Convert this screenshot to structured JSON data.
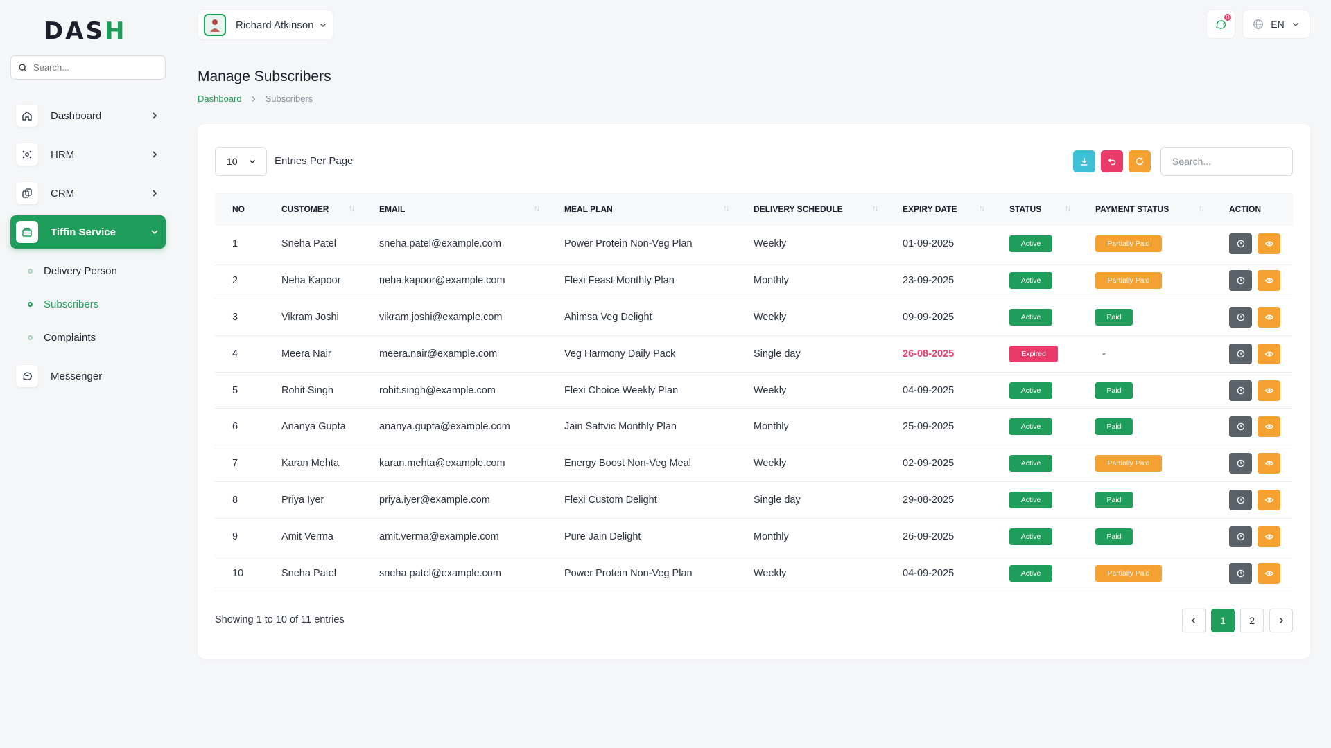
{
  "brand": {
    "logo_main": "DAS",
    "logo_accent": "H"
  },
  "sidebar": {
    "search_placeholder": "Search...",
    "items": [
      {
        "label": "Dashboard",
        "icon": "home-icon"
      },
      {
        "label": "HRM",
        "icon": "hrm-icon"
      },
      {
        "label": "CRM",
        "icon": "crm-icon"
      },
      {
        "label": "Tiffin Service",
        "icon": "tiffin-icon",
        "active": true
      },
      {
        "label": "Messenger",
        "icon": "chat-icon"
      }
    ],
    "sub_items": [
      {
        "label": "Delivery Person"
      },
      {
        "label": "Subscribers",
        "current": true
      },
      {
        "label": "Complaints"
      }
    ]
  },
  "header": {
    "user_name": "Richard Atkinson",
    "notification_count": "0",
    "language": "EN"
  },
  "page": {
    "title": "Manage Subscribers",
    "breadcrumb_home": "Dashboard",
    "breadcrumb_current": "Subscribers"
  },
  "table_controls": {
    "per_page_value": "10",
    "per_page_label": "Entries Per Page",
    "search_placeholder": "Search..."
  },
  "table": {
    "columns": [
      "NO",
      "CUSTOMER",
      "EMAIL",
      "MEAL PLAN",
      "DELIVERY SCHEDULE",
      "EXPIRY DATE",
      "STATUS",
      "PAYMENT STATUS",
      "ACTION"
    ],
    "rows": [
      {
        "no": "1",
        "customer": "Sneha Patel",
        "email": "sneha.patel@example.com",
        "plan": "Power Protein Non-Veg Plan",
        "schedule": "Weekly",
        "expiry": "01-09-2025",
        "status": "Active",
        "payment": "Partially Paid"
      },
      {
        "no": "2",
        "customer": "Neha Kapoor",
        "email": "neha.kapoor@example.com",
        "plan": "Flexi Feast Monthly Plan",
        "schedule": "Monthly",
        "expiry": "23-09-2025",
        "status": "Active",
        "payment": "Partially Paid"
      },
      {
        "no": "3",
        "customer": "Vikram Joshi",
        "email": "vikram.joshi@example.com",
        "plan": "Ahimsa Veg Delight",
        "schedule": "Weekly",
        "expiry": "09-09-2025",
        "status": "Active",
        "payment": "Paid"
      },
      {
        "no": "4",
        "customer": "Meera Nair",
        "email": "meera.nair@example.com",
        "plan": "Veg Harmony Daily Pack",
        "schedule": "Single day",
        "expiry": "26-08-2025",
        "status": "Expired",
        "payment": "-"
      },
      {
        "no": "5",
        "customer": "Rohit Singh",
        "email": "rohit.singh@example.com",
        "plan": "Flexi Choice Weekly Plan",
        "schedule": "Weekly",
        "expiry": "04-09-2025",
        "status": "Active",
        "payment": "Paid"
      },
      {
        "no": "6",
        "customer": "Ananya Gupta",
        "email": "ananya.gupta@example.com",
        "plan": "Jain Sattvic Monthly Plan",
        "schedule": "Monthly",
        "expiry": "25-09-2025",
        "status": "Active",
        "payment": "Paid"
      },
      {
        "no": "7",
        "customer": "Karan Mehta",
        "email": "karan.mehta@example.com",
        "plan": "Energy Boost Non-Veg Meal",
        "schedule": "Weekly",
        "expiry": "02-09-2025",
        "status": "Active",
        "payment": "Partially Paid"
      },
      {
        "no": "8",
        "customer": "Priya Iyer",
        "email": "priya.iyer@example.com",
        "plan": "Flexi Custom Delight",
        "schedule": "Single day",
        "expiry": "29-08-2025",
        "status": "Active",
        "payment": "Paid"
      },
      {
        "no": "9",
        "customer": "Amit Verma",
        "email": "amit.verma@example.com",
        "plan": "Pure Jain Delight",
        "schedule": "Monthly",
        "expiry": "26-09-2025",
        "status": "Active",
        "payment": "Paid"
      },
      {
        "no": "10",
        "customer": "Sneha Patel",
        "email": "sneha.patel@example.com",
        "plan": "Power Protein Non-Veg Plan",
        "schedule": "Weekly",
        "expiry": "04-09-2025",
        "status": "Active",
        "payment": "Partially Paid"
      }
    ]
  },
  "footer": {
    "showing_text": "Showing 1 to 10 of 11 entries",
    "pages": [
      "1",
      "2"
    ],
    "current_page": "1"
  },
  "colors": {
    "primary": "#1e9e5a",
    "danger": "#ea3a6a",
    "warning": "#f5a131",
    "info": "#3ec1d6",
    "dark": "#5b6169"
  }
}
